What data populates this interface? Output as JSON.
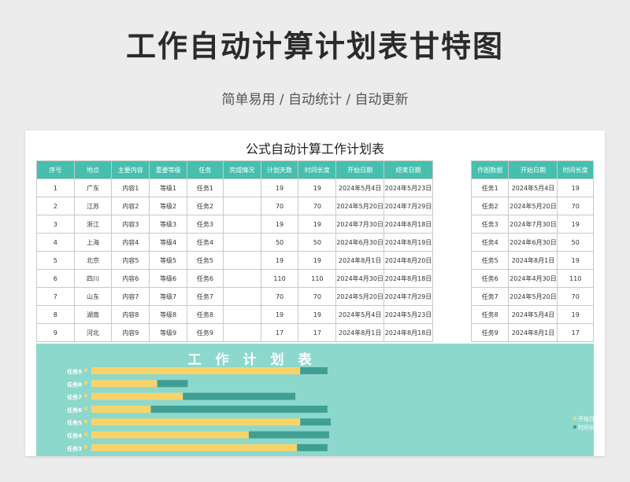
{
  "header": {
    "title": "工作自动计算计划表甘特图",
    "subtitle": "简单易用 / 自动统计 / 自动更新"
  },
  "sheet": {
    "title": "公式自动计算工作计划表",
    "columns": [
      "序号",
      "地点",
      "主要内容",
      "重要等级",
      "任务",
      "完成情况",
      "计划天数",
      "时间长度",
      "开始日期",
      "结束日期"
    ],
    "rows": [
      [
        "1",
        "广东",
        "内容1",
        "等级1",
        "任务1",
        "",
        "19",
        "19",
        "2024年5月4日",
        "2024年5月23日"
      ],
      [
        "2",
        "江苏",
        "内容2",
        "等级2",
        "任务2",
        "",
        "70",
        "70",
        "2024年5月20日",
        "2024年7月29日"
      ],
      [
        "3",
        "浙江",
        "内容3",
        "等级3",
        "任务3",
        "",
        "19",
        "19",
        "2024年7月30日",
        "2024年8月18日"
      ],
      [
        "4",
        "上海",
        "内容4",
        "等级4",
        "任务4",
        "",
        "50",
        "50",
        "2024年6月30日",
        "2024年8月19日"
      ],
      [
        "5",
        "北京",
        "内容5",
        "等级5",
        "任务5",
        "",
        "19",
        "19",
        "2024年8月1日",
        "2024年8月20日"
      ],
      [
        "6",
        "四川",
        "内容6",
        "等级6",
        "任务6",
        "",
        "110",
        "110",
        "2024年4月30日",
        "2024年8月18日"
      ],
      [
        "7",
        "山东",
        "内容7",
        "等级7",
        "任务7",
        "",
        "70",
        "70",
        "2024年5月20日",
        "2024年7月29日"
      ],
      [
        "8",
        "湖南",
        "内容8",
        "等级8",
        "任务8",
        "",
        "19",
        "19",
        "2024年5月4日",
        "2024年5月23日"
      ],
      [
        "9",
        "河北",
        "内容9",
        "等级9",
        "任务9",
        "",
        "17",
        "17",
        "2024年8月1日",
        "2024年8月18日"
      ]
    ]
  },
  "chart_source": {
    "columns": [
      "作图数据",
      "开始日期",
      "时间长度"
    ],
    "rows": [
      [
        "任务1",
        "2024年5月4日",
        "19"
      ],
      [
        "任务2",
        "2024年5月20日",
        "70"
      ],
      [
        "任务3",
        "2024年7月30日",
        "19"
      ],
      [
        "任务4",
        "2024年6月30日",
        "50"
      ],
      [
        "任务5",
        "2024年8月1日",
        "19"
      ],
      [
        "任务6",
        "2024年4月30日",
        "110"
      ],
      [
        "任务7",
        "2024年5月20日",
        "70"
      ],
      [
        "任务8",
        "2024年5月4日",
        "19"
      ],
      [
        "任务9",
        "2024年8月1日",
        "17"
      ]
    ]
  },
  "chart_data": {
    "type": "bar",
    "orientation": "horizontal-stacked",
    "title": "工作计划表",
    "categories": [
      "任务9",
      "任务8",
      "任务7",
      "任务6",
      "任务5",
      "任务4",
      "任务3"
    ],
    "series": [
      {
        "name": "开始日期",
        "values": [
          "2024-08-01",
          "2024-05-04",
          "2024-05-20",
          "2024-04-30",
          "2024-08-01",
          "2024-06-30",
          "2024-07-30"
        ],
        "color": "#f7d36a"
      },
      {
        "name": "时间长度",
        "values": [
          17,
          19,
          70,
          110,
          19,
          50,
          19
        ],
        "color": "#3f9f93"
      }
    ],
    "legend_position": "right",
    "grid": false
  },
  "colors": {
    "header": "#47bfae",
    "chart_bg": "#8dd8cd",
    "start": "#f7d36a",
    "duration": "#3f9f93"
  }
}
